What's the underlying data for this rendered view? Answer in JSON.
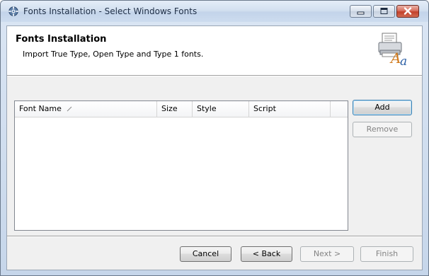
{
  "window": {
    "title": "Fonts Installation - Select Windows Fonts",
    "app_icon": "gear-icon"
  },
  "header": {
    "title": "Fonts Installation",
    "subtitle": "Import True Type, Open Type and Type 1 fonts.",
    "art_icon": "printer-font-icon"
  },
  "font_list": {
    "columns": [
      "Font Name",
      "Size",
      "Style",
      "Script"
    ],
    "rows": []
  },
  "side_buttons": {
    "add": "Add",
    "remove": "Remove"
  },
  "footer": {
    "cancel": "Cancel",
    "back": "< Back",
    "next": "Next >",
    "finish": "Finish"
  }
}
